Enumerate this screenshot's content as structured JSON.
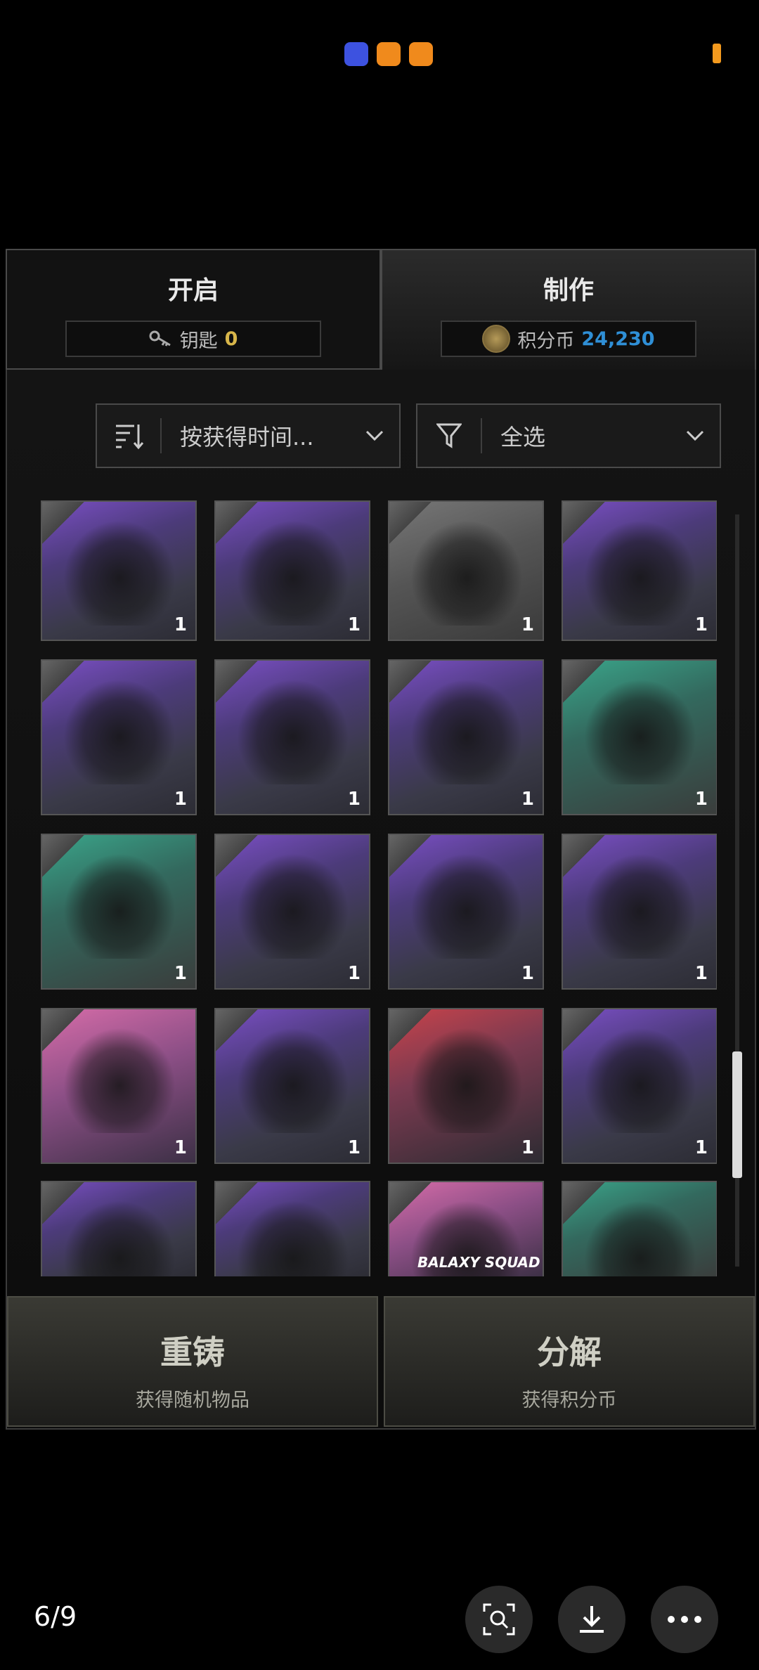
{
  "tabs": {
    "open": {
      "title": "开启",
      "sub_label": "钥匙",
      "sub_value": "0"
    },
    "craft": {
      "title": "制作",
      "sub_label": "积分币",
      "sub_value": "24,230"
    }
  },
  "sort_dropdown": {
    "label": "按获得时间..."
  },
  "filter_dropdown": {
    "label": "全选"
  },
  "items": [
    {
      "count": "1",
      "color": "purple",
      "icon": "tuxedo-jacket"
    },
    {
      "count": "1",
      "color": "purple",
      "icon": "white-socks-shoes"
    },
    {
      "count": "1",
      "color": "grey",
      "icon": "dance-emote"
    },
    {
      "count": "1",
      "color": "purple",
      "icon": "leather-jacket"
    },
    {
      "count": "1",
      "color": "purple",
      "icon": "cat-costume-outfit"
    },
    {
      "count": "1",
      "color": "purple",
      "icon": "backpack"
    },
    {
      "count": "1",
      "color": "purple",
      "icon": "white-backpack"
    },
    {
      "count": "1",
      "color": "green",
      "icon": "gloves"
    },
    {
      "count": "1",
      "color": "green",
      "icon": "white-outfit"
    },
    {
      "count": "1",
      "color": "purple",
      "icon": "winter-outfit"
    },
    {
      "count": "1",
      "color": "purple",
      "icon": "black-top"
    },
    {
      "count": "1",
      "color": "purple",
      "icon": "desert-outfit"
    },
    {
      "count": "1",
      "color": "pink",
      "icon": "pink-outfit"
    },
    {
      "count": "1",
      "color": "purple",
      "icon": "neon-suits"
    },
    {
      "count": "1",
      "color": "red",
      "icon": "dark-outfit"
    },
    {
      "count": "1",
      "color": "purple",
      "icon": "camo-outfit"
    },
    {
      "count": "",
      "color": "purple",
      "icon": "sunglasses-outfit"
    },
    {
      "count": "",
      "color": "purple",
      "icon": "red-jacket-outfit"
    },
    {
      "count": "",
      "color": "pink",
      "icon": "galaxy-squad-outfit",
      "label": "BALAXY SQUAD"
    },
    {
      "count": "",
      "color": "green",
      "icon": "cheer-emote"
    }
  ],
  "buttons": {
    "recast": {
      "title": "重铸",
      "sub": "获得随机物品"
    },
    "decompose": {
      "title": "分解",
      "sub": "获得积分币"
    }
  },
  "viewer": {
    "page_counter": "6/9"
  },
  "colors": {
    "coin": "#2f8fd6",
    "key": "#d8b64a",
    "background": "#000000"
  }
}
